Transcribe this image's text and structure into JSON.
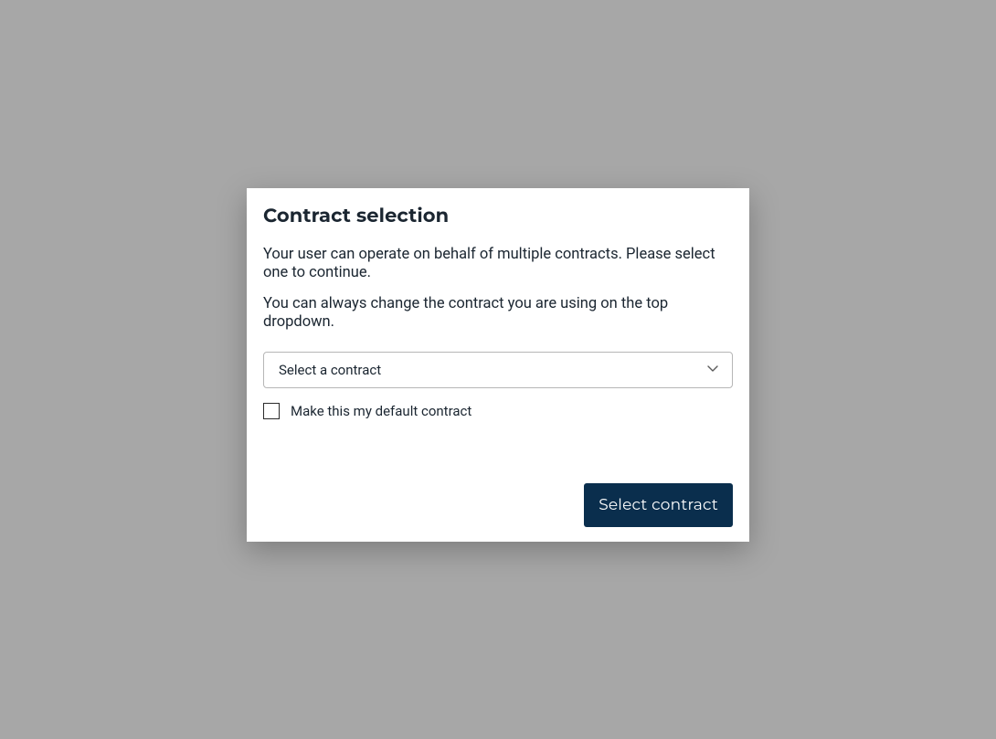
{
  "modal": {
    "title": "Contract selection",
    "paragraphs": {
      "p1": "Your user can operate on behalf of multiple contracts. Please select one to continue.",
      "p2": "You can always change the contract you are using on the top dropdown."
    },
    "select": {
      "placeholder": "Select a contract",
      "value": ""
    },
    "checkbox": {
      "label": "Make this my default contract",
      "checked": false
    },
    "submit_label": "Select contract"
  },
  "colors": {
    "primary": "#0a2e4d",
    "backdrop": "#a7a7a7"
  }
}
